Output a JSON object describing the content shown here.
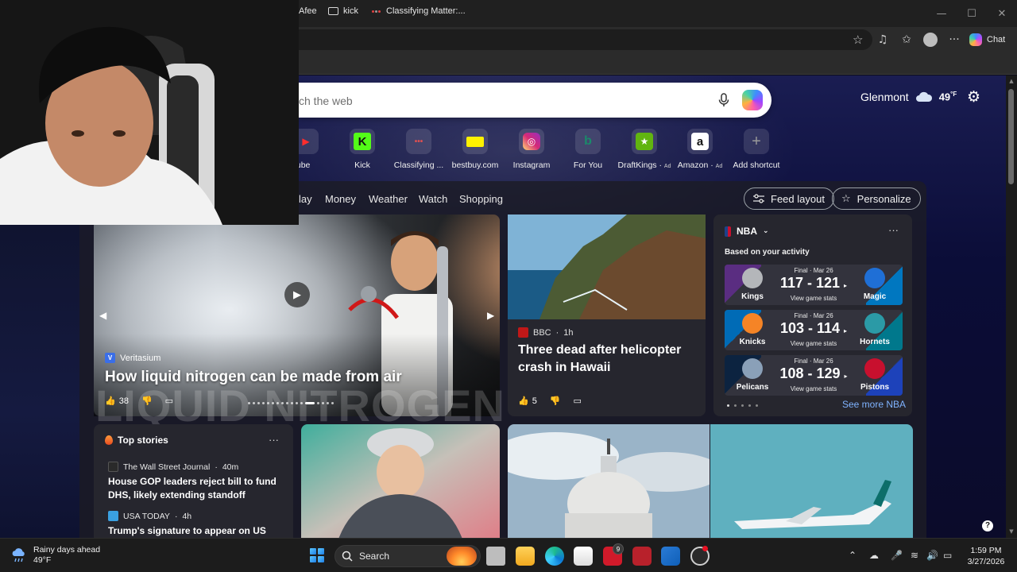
{
  "window": {
    "minimize": "—",
    "maximize": "☐",
    "close": "✕"
  },
  "toolbar": {
    "chat_label": "Chat"
  },
  "bookmarks": [
    {
      "label": "Afee"
    },
    {
      "label": "kick"
    },
    {
      "label": "Classifying Matter:..."
    }
  ],
  "search": {
    "placeholder": "ch the web"
  },
  "weather": {
    "city": "Glenmont",
    "temp": "49",
    "unit": "°F"
  },
  "shortcuts": [
    {
      "label": "uTube",
      "glyph": "▶",
      "color": "#ff2d2d"
    },
    {
      "label": "Kick",
      "glyph": "K",
      "color": "#53fc18"
    },
    {
      "label": "Classifying ...",
      "glyph": "•••",
      "color": "#b04040"
    },
    {
      "label": "bestbuy.com",
      "glyph": "◆",
      "color": "#fff200"
    },
    {
      "label": "Instagram",
      "glyph": "◎",
      "color": "#e1306c"
    },
    {
      "label": "For You",
      "glyph": "b",
      "color": "#1a8a6a"
    },
    {
      "label": "DraftKings",
      "ad": "Ad",
      "glyph": "★",
      "color": "#61b510"
    },
    {
      "label": "Amazon",
      "ad": "Ad",
      "glyph": "a",
      "color": "#ffffff"
    },
    {
      "label": "Add shortcut",
      "glyph": "+",
      "color": "#8a8a8a"
    }
  ],
  "feed_nav": [
    "lay",
    "Money",
    "Weather",
    "Watch",
    "Shopping"
  ],
  "feed_buttons": {
    "layout": "Feed layout",
    "personalize": "Personalize"
  },
  "hero": {
    "source": "Veritasium",
    "source_badge": "V",
    "title": "How liquid nitrogen can be made from air",
    "watermark": "LIQUID NITROGEN",
    "likes": "38"
  },
  "hawaii": {
    "source": "BBC",
    "time": "1h",
    "title": "Three dead after helicopter crash in Hawaii",
    "likes": "5"
  },
  "nba": {
    "title": "NBA",
    "subtitle": "Based on your activity",
    "more": "···",
    "see_more": "See more NBA",
    "games": [
      {
        "status": "Final · Mar 26",
        "score": "117 - 121",
        "stats": "View game stats",
        "home": "Kings",
        "away": "Magic",
        "home_color": "#5a2d81",
        "away_color": "#0077c0"
      },
      {
        "status": "Final · Mar 26",
        "score": "103 - 114",
        "stats": "View game stats",
        "home": "Knicks",
        "away": "Hornets",
        "home_color": "#006bb6",
        "away_color": "#00788c"
      },
      {
        "status": "Final · Mar 26",
        "score": "108 - 129",
        "stats": "View game stats",
        "home": "Pelicans",
        "away": "Pistons",
        "home_color": "#0c2340",
        "away_color": "#1d42ba"
      }
    ]
  },
  "top_stories": {
    "title": "Top stories",
    "more": "···",
    "items": [
      {
        "source": "The Wall Street Journal",
        "time": "40m",
        "title": "House GOP leaders reject bill to fund DHS, likely extending standoff"
      },
      {
        "source": "USA TODAY",
        "time": "4h",
        "title": "Trump's signature to appear on US"
      }
    ]
  },
  "taskbar": {
    "weather_line1": "Rainy days ahead",
    "weather_line2": "49°F",
    "search_label": "Search",
    "badge": "9",
    "time": "1:59 PM",
    "date": "3/27/2026"
  }
}
